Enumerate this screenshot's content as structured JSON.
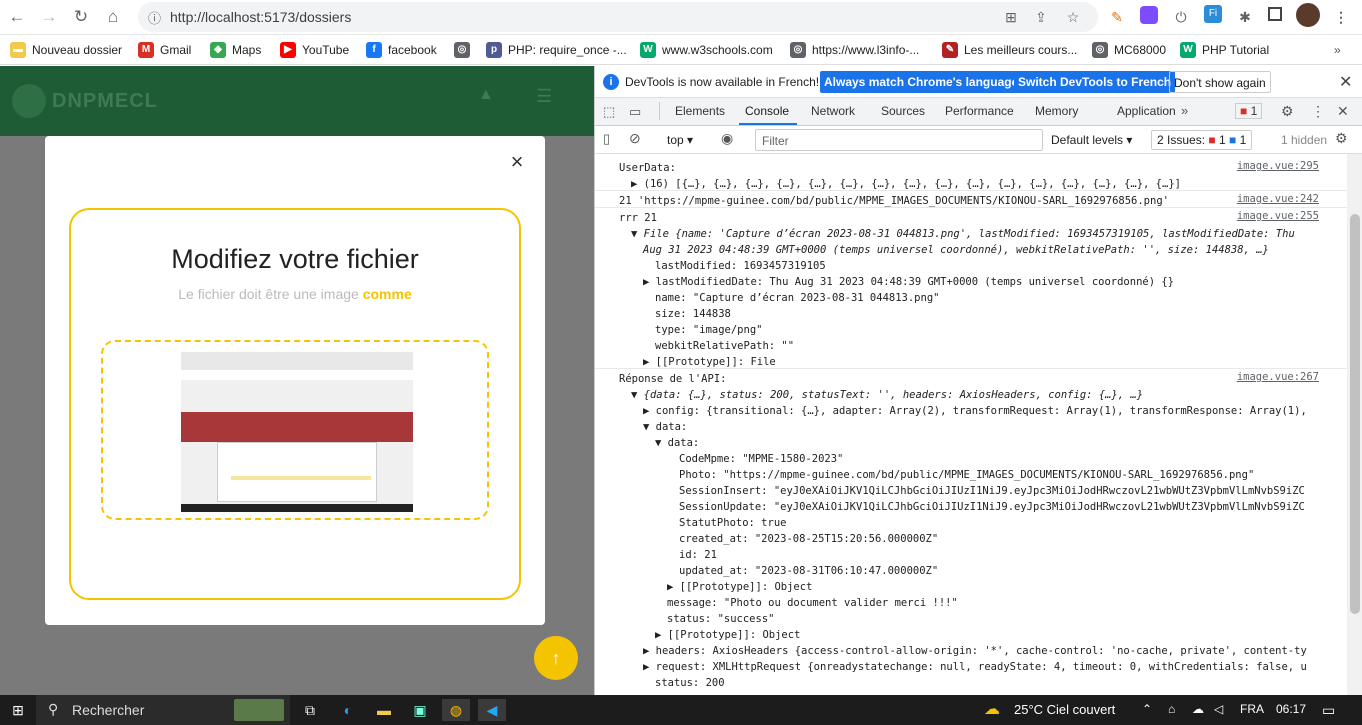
{
  "browser": {
    "url": "http://localhost:5173/dossiers",
    "bookmarks": [
      {
        "label": "Nouveau dossier",
        "icon": "folder-icon",
        "color": "#f2c94c"
      },
      {
        "label": "Gmail",
        "icon": "gmail-icon",
        "color": "#d93025"
      },
      {
        "label": "Maps",
        "icon": "maps-icon",
        "color": "#34a853"
      },
      {
        "label": "YouTube",
        "icon": "youtube-icon",
        "color": "#ff0000"
      },
      {
        "label": "facebook",
        "icon": "facebook-icon",
        "color": "#1877f2"
      },
      {
        "label": "",
        "icon": "globe-icon",
        "color": "#5f6368"
      },
      {
        "label": "PHP: require_once -...",
        "icon": "php-icon",
        "color": "#4f5b93"
      },
      {
        "label": "www.w3schools.com",
        "icon": "w3schools-icon",
        "color": "#04aa6d"
      },
      {
        "label": "https://www.l3info-...",
        "icon": "globe-icon",
        "color": "#5f6368"
      },
      {
        "label": "Les meilleurs cours...",
        "icon": "cours-icon",
        "color": "#b22222"
      },
      {
        "label": "MC68000",
        "icon": "globe-icon",
        "color": "#5f6368"
      },
      {
        "label": "PHP Tutorial",
        "icon": "w3schools-icon",
        "color": "#04aa6d"
      }
    ]
  },
  "app": {
    "brand": "DNPMECL",
    "modal": {
      "title": "Modifiez votre fichier",
      "subtitle": "Le fichier doit être une image ",
      "subtitle_em": "comme",
      "close": "×"
    }
  },
  "devtools": {
    "infobar": {
      "text": "DevTools is now available in French!",
      "btn1": "Always match Chrome's language",
      "btn2": "Switch DevTools to French",
      "btn3": "Don't show again"
    },
    "tabs": [
      "Elements",
      "Console",
      "Network",
      "Sources",
      "Performance",
      "Memory",
      "Application"
    ],
    "active_tab": "Console",
    "error_count": "1",
    "toolbar": {
      "context": "top",
      "filter_placeholder": "Filter",
      "levels": "Default levels",
      "issues_label": "2 Issues:",
      "issues_err": "1",
      "issues_info": "1",
      "hidden": "1 hidden"
    },
    "console": [
      {
        "t": "UserData:",
        "src": "image.vue:295"
      },
      {
        "t": "▶ (16) [{…}, {…}, {…}, {…}, {…}, {…}, {…}, {…}, {…}, {…}, {…}, {…}, {…}, {…}, {…}, {…}]",
        "ind": 1
      },
      {
        "t": "21 'https://mpme-guinee.com/bd/public/MPME_IMAGES_DOCUMENTS/KIONOU-SARL_1692976856.png'",
        "src": "image.vue:242",
        "sep": true
      },
      {
        "t": "rrr 21",
        "src": "image.vue:255",
        "sep": true
      },
      {
        "t": "▼ File {name: 'Capture d’écran 2023-08-31 044813.png', lastModified: 1693457319105, lastModifiedDate: Thu",
        "ind": 1,
        "cls": "i"
      },
      {
        "t": "Aug 31 2023 04:48:39 GMT+0000 (temps universel coordonné), webkitRelativePath: '', size: 144838, …}",
        "ind": 2,
        "cls": "i"
      },
      {
        "t": "lastModified: 1693457319105",
        "ind": 3
      },
      {
        "t": "▶ lastModifiedDate: Thu Aug 31 2023 04:48:39 GMT+0000 (temps universel coordonné) {}",
        "ind": 2
      },
      {
        "t": "name: \"Capture d’écran 2023-08-31 044813.png\"",
        "ind": 3
      },
      {
        "t": "size: 144838",
        "ind": 3
      },
      {
        "t": "type: \"image/png\"",
        "ind": 3
      },
      {
        "t": "webkitRelativePath: \"\"",
        "ind": 3
      },
      {
        "t": "▶ [[Prototype]]: File",
        "ind": 2
      },
      {
        "t": "Réponse de l'API:",
        "src": "image.vue:267",
        "sep": true
      },
      {
        "t": "▼ {data: {…}, status: 200, statusText: '', headers: AxiosHeaders, config: {…}, …}",
        "ind": 1,
        "cls": "i"
      },
      {
        "t": "▶ config: {transitional: {…}, adapter: Array(2), transformRequest: Array(1), transformResponse: Array(1),",
        "ind": 2
      },
      {
        "t": "▼ data:",
        "ind": 2
      },
      {
        "t": "▼ data:",
        "ind": 3
      },
      {
        "t": "CodeMpme: \"MPME-1580-2023\"",
        "ind": 5
      },
      {
        "t": "Photo: \"https://mpme-guinee.com/bd/public/MPME_IMAGES_DOCUMENTS/KIONOU-SARL_1692976856.png\"",
        "ind": 5
      },
      {
        "t": "SessionInsert: \"eyJ0eXAiOiJKV1QiLCJhbGciOiJIUzI1NiJ9.eyJpc3MiOiJodHRwczovL21wbWUtZ3VpbmVlLmNvbS9iZC",
        "ind": 5
      },
      {
        "t": "SessionUpdate: \"eyJ0eXAiOiJKV1QiLCJhbGciOiJIUzI1NiJ9.eyJpc3MiOiJodHRwczovL21wbWUtZ3VpbmVlLmNvbS9iZC",
        "ind": 5
      },
      {
        "t": "StatutPhoto: true",
        "ind": 5
      },
      {
        "t": "created_at: \"2023-08-25T15:20:56.000000Z\"",
        "ind": 5
      },
      {
        "t": "id: 21",
        "ind": 5
      },
      {
        "t": "updated_at: \"2023-08-31T06:10:47.000000Z\"",
        "ind": 5
      },
      {
        "t": "▶ [[Prototype]]: Object",
        "ind": 4
      },
      {
        "t": "message: \"Photo ou document valider merci !!!\"",
        "ind": 4
      },
      {
        "t": "status: \"success\"",
        "ind": 4
      },
      {
        "t": "▶ [[Prototype]]: Object",
        "ind": 3
      },
      {
        "t": "▶ headers: AxiosHeaders {access-control-allow-origin: '*', cache-control: 'no-cache, private', content-ty",
        "ind": 2
      },
      {
        "t": "▶ request: XMLHttpRequest {onreadystatechange: null, readyState: 4, timeout: 0, withCredentials: false, u",
        "ind": 2
      },
      {
        "t": "status: 200",
        "ind": 3
      }
    ]
  },
  "taskbar": {
    "search": "Rechercher",
    "weather": "25°C  Ciel couvert",
    "lang": "FRA",
    "time": "06:17"
  }
}
